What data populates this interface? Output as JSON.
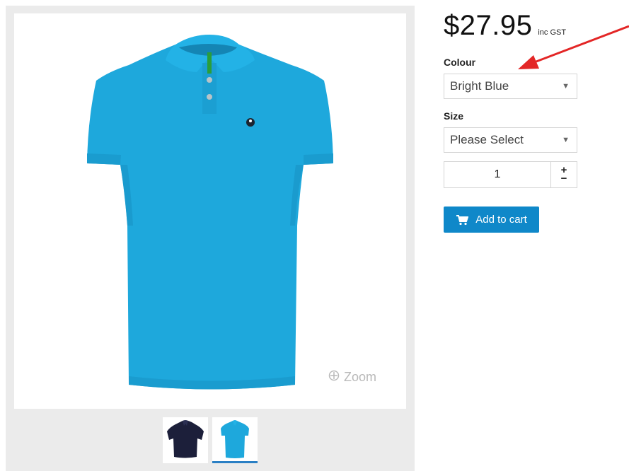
{
  "product": {
    "price": "$27.95",
    "tax_note": "inc GST"
  },
  "colour": {
    "label": "Colour",
    "selected": "Bright Blue"
  },
  "size": {
    "label": "Size",
    "selected": "Please Select"
  },
  "quantity": {
    "value": "1",
    "increment_label": "+",
    "decrement_label": "−"
  },
  "actions": {
    "add_to_cart_label": "Add to cart"
  },
  "gallery": {
    "zoom_label": "Zoom",
    "thumbnails": [
      {
        "name": "navy-polo",
        "color": "#1c1f3a"
      },
      {
        "name": "blue-polo",
        "color": "#1ea8dc",
        "active": true
      }
    ],
    "main_color": "#1ea8dc"
  },
  "colors": {
    "accent": "#0f88c9",
    "annotation_arrow": "#e32626"
  }
}
